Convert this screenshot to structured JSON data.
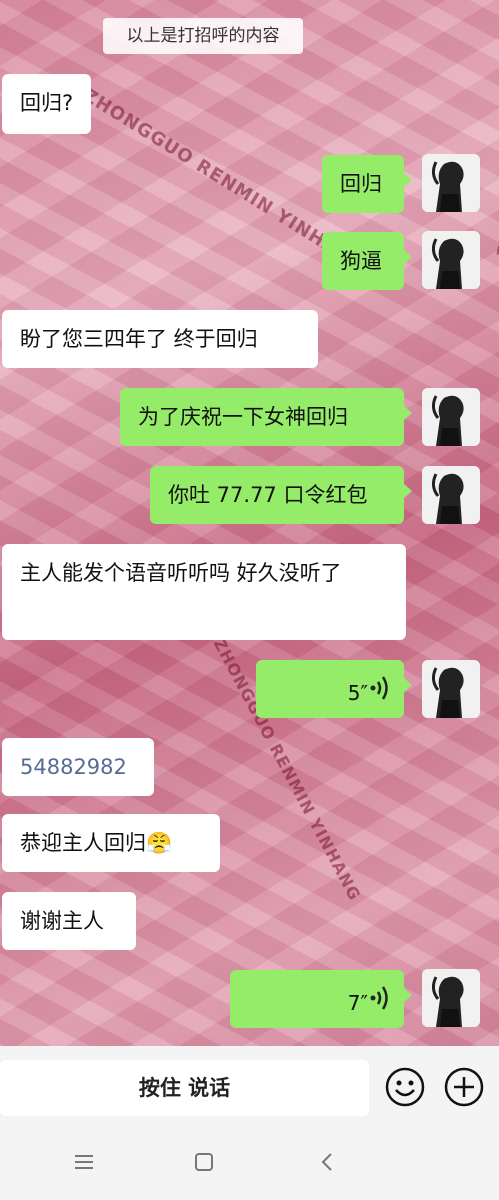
{
  "system_tip": "以上是打招呼的内容",
  "messages": [
    {
      "dir": "in",
      "text": "回归?"
    },
    {
      "dir": "out",
      "text": "回归"
    },
    {
      "dir": "out",
      "text": "狗逼"
    },
    {
      "dir": "in",
      "text": "盼了您三四年了 终于回归"
    },
    {
      "dir": "out",
      "text": "为了庆祝一下女神回归"
    },
    {
      "dir": "out",
      "text": "你吐 77.77 口令红包"
    },
    {
      "dir": "in",
      "text": "主人能发个语音听听吗 好久没听了"
    },
    {
      "dir": "out",
      "voice": "5″"
    },
    {
      "dir": "in",
      "text": "54882982"
    },
    {
      "dir": "in",
      "text": "恭迎主人回归😤"
    },
    {
      "dir": "in",
      "text": "谢谢主人"
    },
    {
      "dir": "out",
      "voice": "7″"
    }
  ],
  "input_bar": {
    "hold_to_talk": "按住 说话"
  },
  "icons": {
    "emoji": "emoji-icon",
    "plus": "plus-icon",
    "voice": "voice-wave-icon"
  },
  "colors": {
    "out_bubble": "#95ec69",
    "in_bubble": "#ffffff",
    "link": "#576b95"
  }
}
